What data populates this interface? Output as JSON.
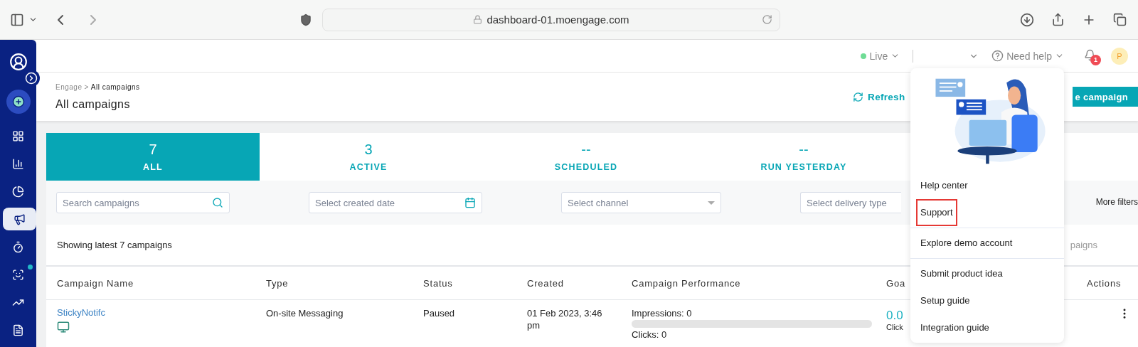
{
  "browser": {
    "url": "dashboard-01.moengage.com"
  },
  "sidebar": {
    "items": [
      {
        "kind": "dashboard",
        "selected": false,
        "dot": false
      },
      {
        "kind": "bars",
        "selected": false,
        "dot": false
      },
      {
        "kind": "pie",
        "selected": false,
        "dot": false
      },
      {
        "kind": "megaphone",
        "selected": true,
        "dot": false
      },
      {
        "kind": "timer",
        "selected": false,
        "dot": false
      },
      {
        "kind": "person",
        "selected": false,
        "dot": true
      },
      {
        "kind": "trend",
        "selected": false,
        "dot": false
      },
      {
        "kind": "document",
        "selected": false,
        "dot": false
      }
    ]
  },
  "top_bar": {
    "environment": {
      "label": "Live",
      "color": "#6fdc95"
    },
    "help": "Need help",
    "notifications": "1",
    "avatar": "P"
  },
  "page_header": {
    "breadcrumb": {
      "parent": "Engage",
      "separator": ">",
      "current": "All campaigns"
    },
    "title": "All campaigns",
    "refresh": "Refresh",
    "create_button": "e campaign"
  },
  "tabs": [
    {
      "count": "7",
      "label": "ALL",
      "selected": true
    },
    {
      "count": "3",
      "label": "ACTIVE",
      "selected": false
    },
    {
      "count": "--",
      "label": "SCHEDULED",
      "selected": false
    },
    {
      "count": "--",
      "label": "RUN YESTERDAY",
      "selected": false
    }
  ],
  "filters": [
    {
      "kind": "search",
      "placeholder": "Search campaigns"
    },
    {
      "kind": "date",
      "placeholder": "Select created date"
    },
    {
      "kind": "select",
      "placeholder": "Select channel"
    },
    {
      "kind": "plain",
      "placeholder": "Select delivery type"
    }
  ],
  "more_filters": "More filters",
  "summary": {
    "text": "Showing latest 7 campaigns",
    "right_fragment": "paigns"
  },
  "table": {
    "columns": [
      "Campaign Name",
      "Type",
      "Status",
      "Created",
      "Campaign Performance",
      "Goa",
      "Actions"
    ],
    "rows": [
      {
        "name": "StickyNotifc",
        "type": "On-site Messaging",
        "status": "Paused",
        "created": "01 Feb 2023, 3:46 pm",
        "performance": {
          "impressions": "Impressions: 0",
          "level": 0,
          "clicks": "Clicks: 0"
        },
        "goal": {
          "value": "0.0",
          "label": "Click"
        }
      }
    ]
  },
  "help_menu": {
    "groups": [
      [
        {
          "label": "Help center",
          "highlighted": false
        },
        {
          "label": "Support",
          "highlighted": true
        }
      ],
      [
        {
          "label": "Explore demo account",
          "highlighted": false
        }
      ],
      [
        {
          "label": "Submit product idea",
          "highlighted": false
        },
        {
          "label": "Setup guide",
          "highlighted": false
        },
        {
          "label": "Integration guide",
          "highlighted": false
        }
      ]
    ]
  }
}
